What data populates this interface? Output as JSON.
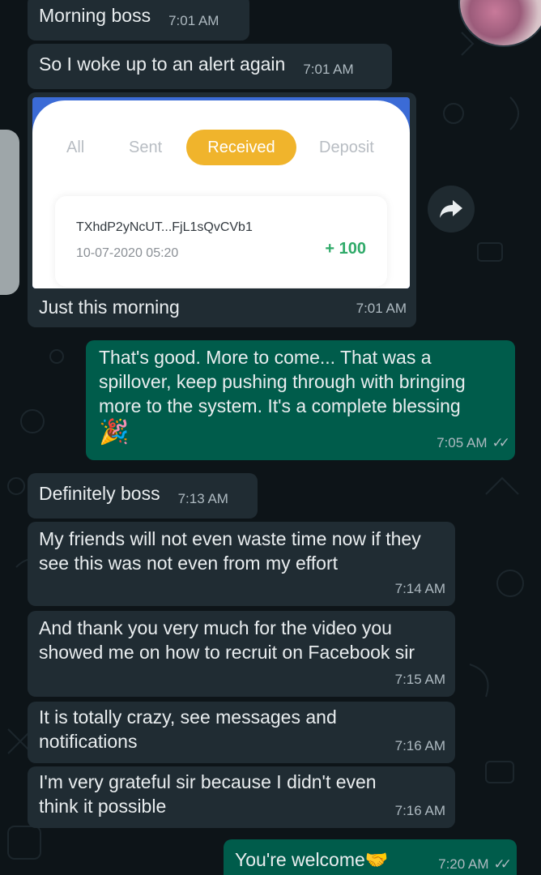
{
  "messages": {
    "m1": {
      "text": "Morning boss",
      "time": "7:01 AM"
    },
    "m2": {
      "text": "So I woke up to an alert again",
      "time": "7:01 AM"
    },
    "m3": {
      "caption": "Just this morning",
      "time": "7:01 AM"
    },
    "m4": {
      "text": "That's good. More to come... That was a spillover, keep pushing through with bringing more to the system. It's a complete blessing",
      "emoji": "🎉",
      "time": "7:05 AM",
      "ticks": "✓✓"
    },
    "m5": {
      "text": "Definitely boss",
      "time": "7:13 AM"
    },
    "m6": {
      "text": "My friends will not even waste time now if they see this was not even from my effort",
      "time": "7:14 AM"
    },
    "m7": {
      "text": "And thank you very much for the video you showed me on how to recruit on Facebook sir",
      "time": "7:15 AM"
    },
    "m8": {
      "text": "It is totally crazy, see messages and notifications",
      "time": "7:16 AM"
    },
    "m9": {
      "text": "I'm very grateful sir because I didn't even think it possible",
      "time": "7:16 AM"
    },
    "m10": {
      "text": "You're welcome",
      "emoji": "🤝",
      "time": "7:20 AM",
      "ticks": "✓✓"
    }
  },
  "screenshot": {
    "tabs": [
      "All",
      "Sent",
      "Received",
      "Deposit"
    ],
    "active_tab": "Received",
    "transaction": {
      "id": "TXhdP2yNcUT...FjL1sQvCVb1",
      "date": "10-07-2020 05:20",
      "amount": "+ 100"
    },
    "accent_color": "#f0b42c",
    "amount_color": "#2faa69"
  },
  "icons": {
    "forward": "forward-arrow-icon",
    "avatar": "contact-avatar"
  },
  "colors": {
    "incoming_bubble": "#202c33",
    "outgoing_bubble": "#005c4b",
    "background": "#0d1418"
  }
}
